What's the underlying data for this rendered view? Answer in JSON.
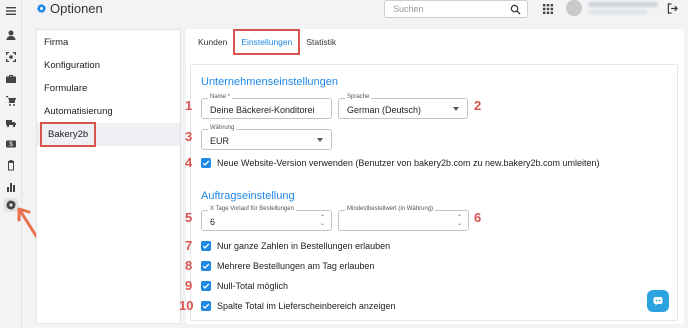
{
  "header": {
    "title": "Optionen",
    "search_placeholder": "Suchen"
  },
  "rail": {
    "icons": [
      "menu-icon",
      "person-icon",
      "scan-icon",
      "briefcase-icon",
      "cart-icon",
      "truck-icon",
      "dollar-icon",
      "clipboard-icon",
      "bar-chart-icon",
      "gear-icon"
    ]
  },
  "nav": {
    "items": [
      "Firma",
      "Konfiguration",
      "Formulare",
      "Automatisierung",
      "Bakery2b"
    ]
  },
  "tabs": [
    "Kunden",
    "Einstellungen",
    "Statistik"
  ],
  "company_settings": {
    "title": "Unternehmenseinstellungen",
    "name_label": "Name *",
    "name_value": "Deine Bäckerei-Konditorei",
    "language_label": "Sprache",
    "language_value": "German (Deutsch)",
    "currency_label": "Währung",
    "currency_value": "EUR",
    "new_version_label": "Neue Website-Version verwenden (Benutzer von bakery2b.com zu new.bakery2b.com umleiten)"
  },
  "order_settings": {
    "title": "Auftragseinstellung",
    "x_days_label": "X Tage Vorlauf für Bestellungen",
    "x_days_value": "6",
    "min_order_label": "Mindestbestellwert (in Währung)",
    "min_order_value": "",
    "checks": [
      "Nur ganze Zahlen in Bestellungen erlauben",
      "Mehrere Bestellungen am Tag erlauben",
      "Null-Total möglich",
      "Spalte Total im Lieferscheinbereich anzeigen"
    ]
  },
  "annotations": [
    "1",
    "2",
    "3",
    "4",
    "5",
    "6",
    "7",
    "8",
    "9",
    "10"
  ],
  "colors": {
    "accent": "#1e88e5",
    "annotation": "#d9534f"
  }
}
